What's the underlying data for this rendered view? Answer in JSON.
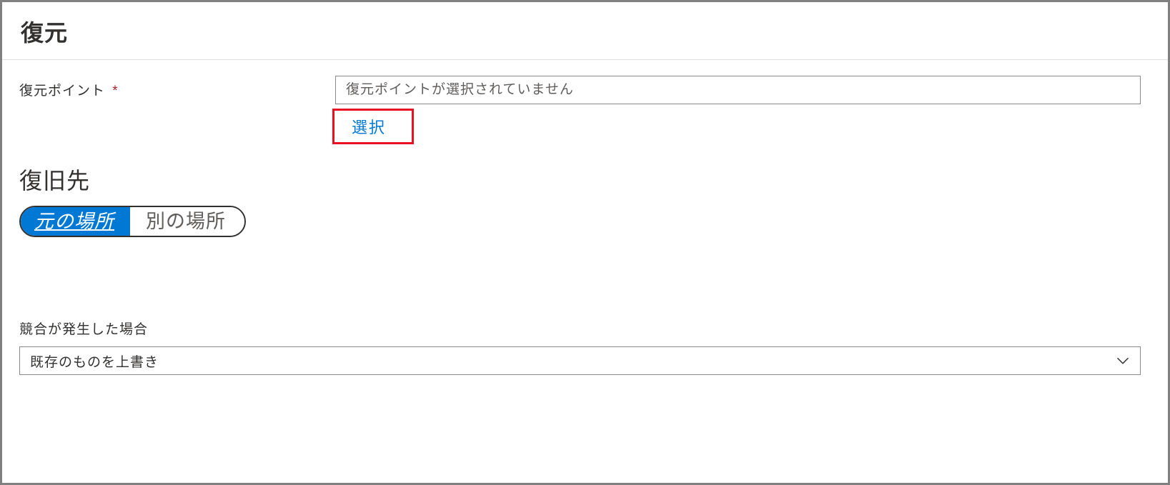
{
  "header": {
    "title": "復元"
  },
  "restorePoint": {
    "label": "復元ポイント",
    "placeholder": "復元ポイントが選択されていません",
    "selectLabel": "選択"
  },
  "destination": {
    "heading": "復旧先",
    "options": {
      "original": "元の場所",
      "alternate": "別の場所"
    }
  },
  "conflict": {
    "label": "競合が発生した場合",
    "selected": "既存のものを上書き"
  }
}
